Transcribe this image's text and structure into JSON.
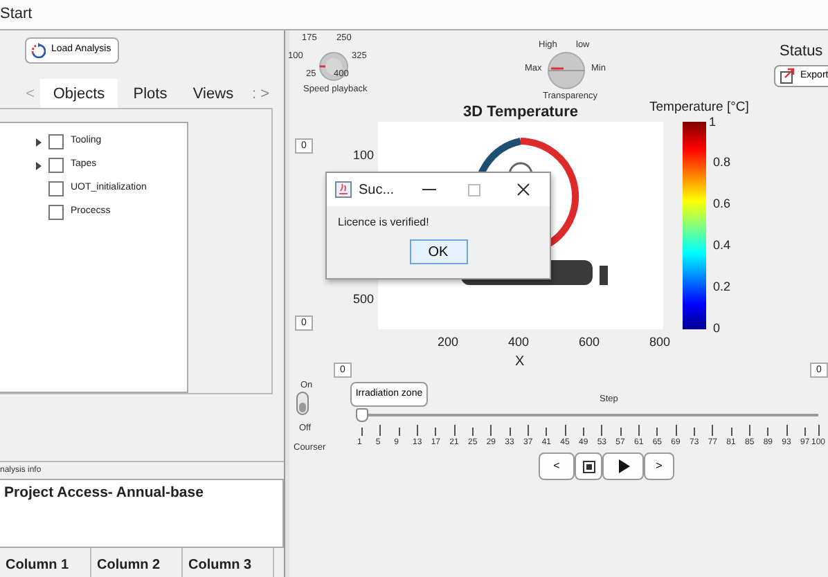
{
  "window": {
    "title": "Start"
  },
  "load_button": {
    "label": "Load Analysis"
  },
  "tab_arrows": [
    "<",
    ": >"
  ],
  "tabs": [
    {
      "label": "Objects",
      "selected": true
    },
    {
      "label": "Plots",
      "selected": false
    },
    {
      "label": "Views",
      "selected": false
    }
  ],
  "tree": [
    {
      "label": "Tooling",
      "checked": false,
      "expandable": true
    },
    {
      "label": "Tapes",
      "checked": false,
      "expandable": true
    },
    {
      "label": "UOT_initialization",
      "checked": false,
      "expandable": false
    },
    {
      "label": "Procecss",
      "checked": false,
      "expandable": false
    }
  ],
  "analysis_info": {
    "title": "nalysis info",
    "project": "Project Access- Annual-base",
    "columns": [
      "Column 1",
      "Column 2",
      "Column 3"
    ]
  },
  "speed_knob": {
    "ticks": [
      "175",
      "250",
      "100",
      "325",
      "25",
      "400"
    ],
    "label": "Speed playback"
  },
  "transparency_knob": {
    "ticks": [
      "High",
      "low",
      "Max",
      "Min"
    ],
    "label": "Transparency"
  },
  "status": {
    "title": "Status",
    "export_button": "Export"
  },
  "plot": {
    "title": "3D Temperature",
    "yticks": [
      "100",
      "500"
    ],
    "xticks": [
      "200",
      "400",
      "600",
      "800"
    ],
    "xlabel": "X"
  },
  "colorbar": {
    "title": "Temperature [°C]",
    "ticks": [
      "1",
      "0.8",
      "0.6",
      "0.4",
      "0.2",
      "0"
    ]
  },
  "value_boxes": [
    "0",
    "0",
    "0",
    "0"
  ],
  "courser_switch": {
    "on_label": "On",
    "off_label": "Off",
    "label": "Courser",
    "on": false
  },
  "irradiation_button": "Irradiation zone",
  "step_slider": {
    "label": "Step",
    "level": 0,
    "ticks": [
      "1",
      "5",
      "9",
      "13",
      "17",
      "21",
      "25",
      "29",
      "33",
      "37",
      "41",
      "45",
      "49",
      "53",
      "57",
      "61",
      "65",
      "69",
      "73",
      "77",
      "81",
      "85",
      "89",
      "93",
      "97",
      "100"
    ]
  },
  "playback_buttons": [
    {
      "kind": "prev",
      "label": "<"
    },
    {
      "kind": "stop"
    },
    {
      "kind": "play"
    },
    {
      "kind": "next",
      "label": ">"
    }
  ],
  "dialog": {
    "title": "Suc...",
    "message": "Licence is verified!",
    "ok": "OK"
  }
}
